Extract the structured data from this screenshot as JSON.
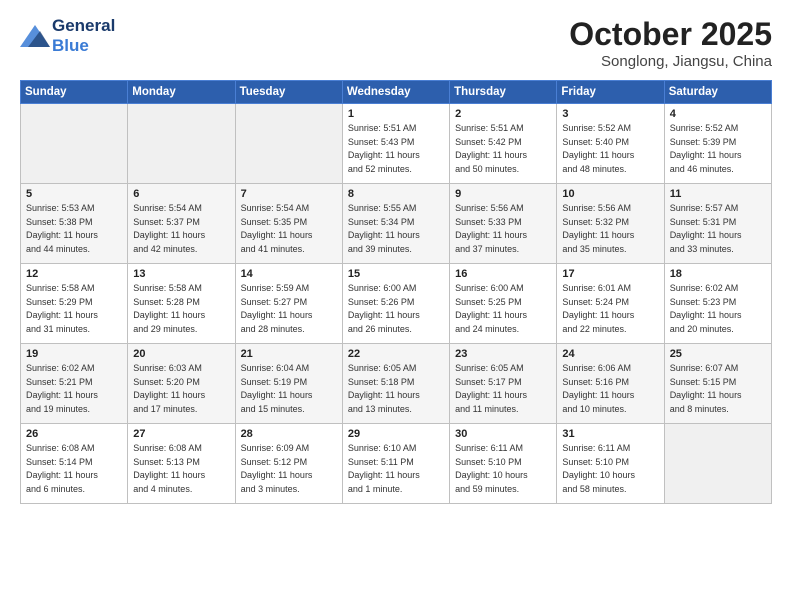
{
  "logo": {
    "part1": "General",
    "part2": "Blue"
  },
  "header": {
    "month": "October 2025",
    "location": "Songlong, Jiangsu, China"
  },
  "weekdays": [
    "Sunday",
    "Monday",
    "Tuesday",
    "Wednesday",
    "Thursday",
    "Friday",
    "Saturday"
  ],
  "weeks": [
    [
      {
        "day": "",
        "info": ""
      },
      {
        "day": "",
        "info": ""
      },
      {
        "day": "",
        "info": ""
      },
      {
        "day": "1",
        "info": "Sunrise: 5:51 AM\nSunset: 5:43 PM\nDaylight: 11 hours\nand 52 minutes."
      },
      {
        "day": "2",
        "info": "Sunrise: 5:51 AM\nSunset: 5:42 PM\nDaylight: 11 hours\nand 50 minutes."
      },
      {
        "day": "3",
        "info": "Sunrise: 5:52 AM\nSunset: 5:40 PM\nDaylight: 11 hours\nand 48 minutes."
      },
      {
        "day": "4",
        "info": "Sunrise: 5:52 AM\nSunset: 5:39 PM\nDaylight: 11 hours\nand 46 minutes."
      }
    ],
    [
      {
        "day": "5",
        "info": "Sunrise: 5:53 AM\nSunset: 5:38 PM\nDaylight: 11 hours\nand 44 minutes."
      },
      {
        "day": "6",
        "info": "Sunrise: 5:54 AM\nSunset: 5:37 PM\nDaylight: 11 hours\nand 42 minutes."
      },
      {
        "day": "7",
        "info": "Sunrise: 5:54 AM\nSunset: 5:35 PM\nDaylight: 11 hours\nand 41 minutes."
      },
      {
        "day": "8",
        "info": "Sunrise: 5:55 AM\nSunset: 5:34 PM\nDaylight: 11 hours\nand 39 minutes."
      },
      {
        "day": "9",
        "info": "Sunrise: 5:56 AM\nSunset: 5:33 PM\nDaylight: 11 hours\nand 37 minutes."
      },
      {
        "day": "10",
        "info": "Sunrise: 5:56 AM\nSunset: 5:32 PM\nDaylight: 11 hours\nand 35 minutes."
      },
      {
        "day": "11",
        "info": "Sunrise: 5:57 AM\nSunset: 5:31 PM\nDaylight: 11 hours\nand 33 minutes."
      }
    ],
    [
      {
        "day": "12",
        "info": "Sunrise: 5:58 AM\nSunset: 5:29 PM\nDaylight: 11 hours\nand 31 minutes."
      },
      {
        "day": "13",
        "info": "Sunrise: 5:58 AM\nSunset: 5:28 PM\nDaylight: 11 hours\nand 29 minutes."
      },
      {
        "day": "14",
        "info": "Sunrise: 5:59 AM\nSunset: 5:27 PM\nDaylight: 11 hours\nand 28 minutes."
      },
      {
        "day": "15",
        "info": "Sunrise: 6:00 AM\nSunset: 5:26 PM\nDaylight: 11 hours\nand 26 minutes."
      },
      {
        "day": "16",
        "info": "Sunrise: 6:00 AM\nSunset: 5:25 PM\nDaylight: 11 hours\nand 24 minutes."
      },
      {
        "day": "17",
        "info": "Sunrise: 6:01 AM\nSunset: 5:24 PM\nDaylight: 11 hours\nand 22 minutes."
      },
      {
        "day": "18",
        "info": "Sunrise: 6:02 AM\nSunset: 5:23 PM\nDaylight: 11 hours\nand 20 minutes."
      }
    ],
    [
      {
        "day": "19",
        "info": "Sunrise: 6:02 AM\nSunset: 5:21 PM\nDaylight: 11 hours\nand 19 minutes."
      },
      {
        "day": "20",
        "info": "Sunrise: 6:03 AM\nSunset: 5:20 PM\nDaylight: 11 hours\nand 17 minutes."
      },
      {
        "day": "21",
        "info": "Sunrise: 6:04 AM\nSunset: 5:19 PM\nDaylight: 11 hours\nand 15 minutes."
      },
      {
        "day": "22",
        "info": "Sunrise: 6:05 AM\nSunset: 5:18 PM\nDaylight: 11 hours\nand 13 minutes."
      },
      {
        "day": "23",
        "info": "Sunrise: 6:05 AM\nSunset: 5:17 PM\nDaylight: 11 hours\nand 11 minutes."
      },
      {
        "day": "24",
        "info": "Sunrise: 6:06 AM\nSunset: 5:16 PM\nDaylight: 11 hours\nand 10 minutes."
      },
      {
        "day": "25",
        "info": "Sunrise: 6:07 AM\nSunset: 5:15 PM\nDaylight: 11 hours\nand 8 minutes."
      }
    ],
    [
      {
        "day": "26",
        "info": "Sunrise: 6:08 AM\nSunset: 5:14 PM\nDaylight: 11 hours\nand 6 minutes."
      },
      {
        "day": "27",
        "info": "Sunrise: 6:08 AM\nSunset: 5:13 PM\nDaylight: 11 hours\nand 4 minutes."
      },
      {
        "day": "28",
        "info": "Sunrise: 6:09 AM\nSunset: 5:12 PM\nDaylight: 11 hours\nand 3 minutes."
      },
      {
        "day": "29",
        "info": "Sunrise: 6:10 AM\nSunset: 5:11 PM\nDaylight: 11 hours\nand 1 minute."
      },
      {
        "day": "30",
        "info": "Sunrise: 6:11 AM\nSunset: 5:10 PM\nDaylight: 10 hours\nand 59 minutes."
      },
      {
        "day": "31",
        "info": "Sunrise: 6:11 AM\nSunset: 5:10 PM\nDaylight: 10 hours\nand 58 minutes."
      },
      {
        "day": "",
        "info": ""
      }
    ]
  ]
}
